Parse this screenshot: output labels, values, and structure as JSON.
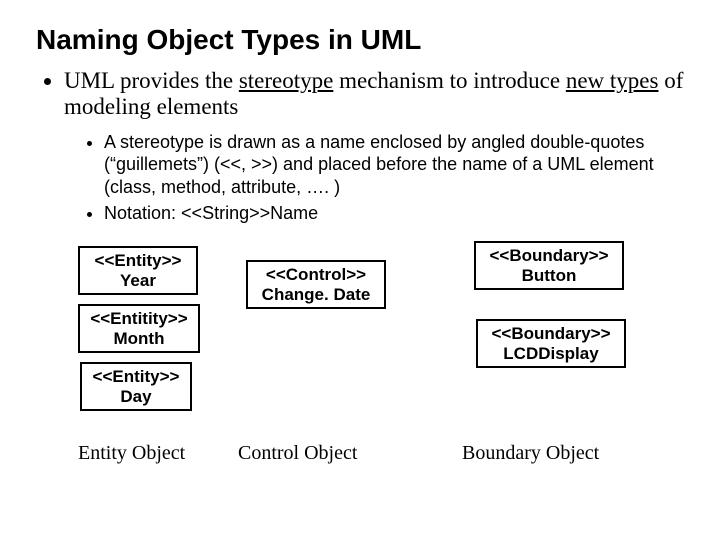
{
  "title": "Naming Object Types in UML",
  "bullets": {
    "main_pre": "UML provides the ",
    "main_u1": "stereotype",
    "main_mid": " mechanism to introduce ",
    "main_u2": "new types",
    "main_post": " of modeling elements",
    "sub1": "A stereotype is drawn as a name enclosed by angled double-quotes (“guillemets”) (<<, >>) and placed before the name of a UML element (class, method, attribute, …. )",
    "sub2": "Notation:  <<String>>Name"
  },
  "boxes": {
    "year": {
      "stereo": "<<Entity>>",
      "name": "Year"
    },
    "month": {
      "stereo": "<<Entitity>>",
      "name": "Month"
    },
    "day": {
      "stereo": "<<Entity>>",
      "name": "Day"
    },
    "change": {
      "stereo": "<<Control>>",
      "name": "Change. Date"
    },
    "button": {
      "stereo": "<<Boundary>>",
      "name": "Button"
    },
    "lcd": {
      "stereo": "<<Boundary>>",
      "name": "LCDDisplay"
    }
  },
  "captions": {
    "entity": "Entity Object",
    "control": "Control Object",
    "boundary": "Boundary Object"
  }
}
